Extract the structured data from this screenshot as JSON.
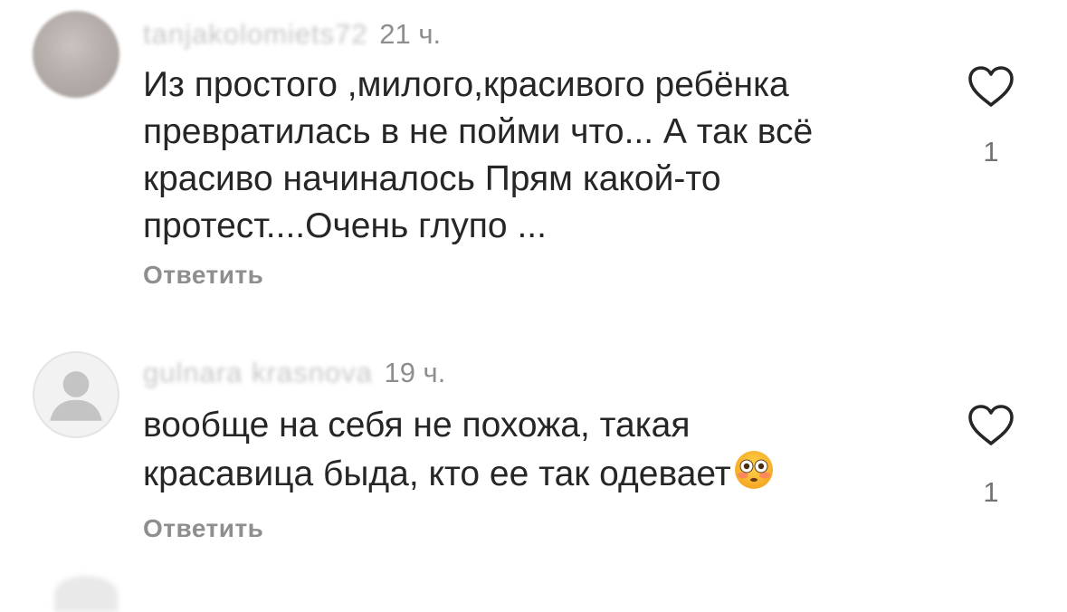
{
  "comments": [
    {
      "username": "tanjakolomiets72",
      "time": "21 ч.",
      "text": "Из простого ,милого,красивого ребёнка\nпревратилась  в  не пойми что... А так всё\nкрасиво начиналось  Прям какой-то\nпротест....Очень глупо ...",
      "reply_label": "Ответить",
      "likes": "1",
      "avatar_icon": "profile-photo",
      "like_icon": "heart-outline-icon"
    },
    {
      "username": "gulnara krasnova",
      "time": "19 ч.",
      "text": "вообще на себя не похожа, такая\nкрасавица быда, кто ее так одевает",
      "emoji": "flushed-face-emoji",
      "reply_label": "Ответить",
      "likes": "1",
      "avatar_icon": "default-user-icon",
      "like_icon": "heart-outline-icon"
    }
  ],
  "colors": {
    "text": "#262626",
    "secondary": "#8e8e8e",
    "username_blurred": "#c7c7c7",
    "background": "#ffffff"
  }
}
